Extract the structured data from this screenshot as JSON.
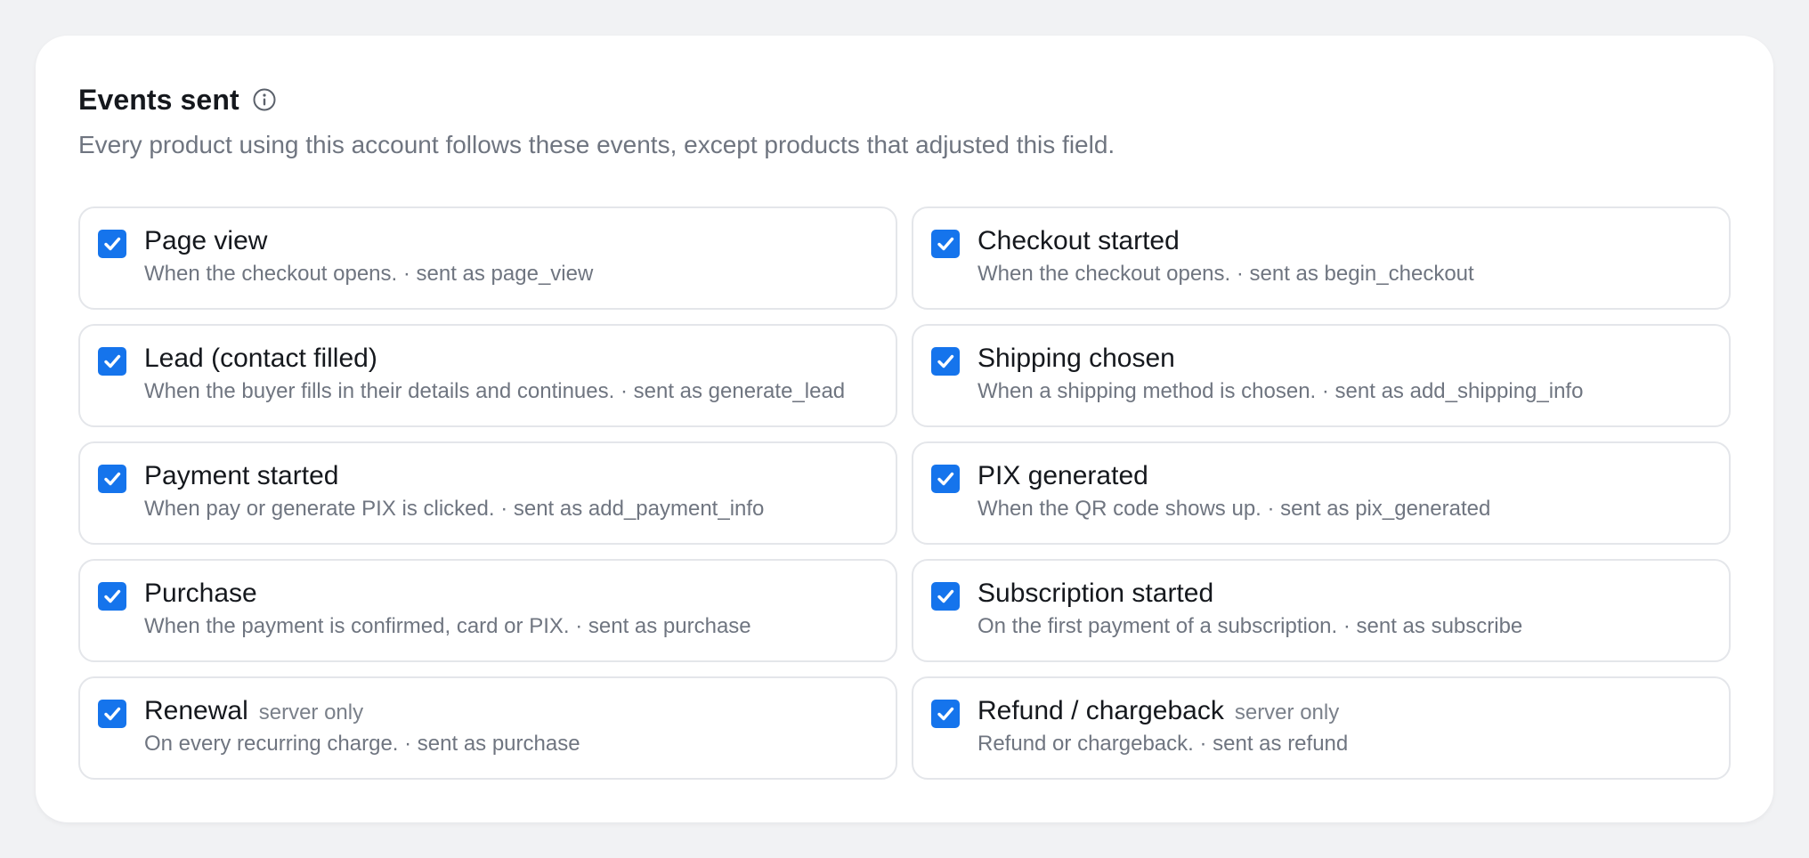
{
  "section": {
    "title": "Events sent",
    "subtitle": "Every product using this account follows these events, except products that adjusted this field."
  },
  "colors": {
    "accent": "#1574ec",
    "background": "#f1f2f4",
    "card": "#ffffff"
  },
  "icons": {
    "info": "info-circle-icon",
    "checkbox": "checkmark-icon"
  },
  "events": [
    {
      "name": "Page view",
      "tag": "",
      "description": "When the checkout opens. · sent as page_view",
      "checked": true
    },
    {
      "name": "Checkout started",
      "tag": "",
      "description": "When the checkout opens. · sent as begin_checkout",
      "checked": true
    },
    {
      "name": "Lead (contact filled)",
      "tag": "",
      "description": "When the buyer fills in their details and continues. · sent as generate_lead",
      "checked": true
    },
    {
      "name": "Shipping chosen",
      "tag": "",
      "description": "When a shipping method is chosen. · sent as add_shipping_info",
      "checked": true
    },
    {
      "name": "Payment started",
      "tag": "",
      "description": "When pay or generate PIX is clicked. · sent as add_payment_info",
      "checked": true
    },
    {
      "name": "PIX generated",
      "tag": "",
      "description": "When the QR code shows up. · sent as pix_generated",
      "checked": true
    },
    {
      "name": "Purchase",
      "tag": "",
      "description": "When the payment is confirmed, card or PIX. · sent as purchase",
      "checked": true
    },
    {
      "name": "Subscription started",
      "tag": "",
      "description": "On the first payment of a subscription. · sent as subscribe",
      "checked": true
    },
    {
      "name": "Renewal",
      "tag": "server only",
      "description": "On every recurring charge. · sent as purchase",
      "checked": true
    },
    {
      "name": "Refund / chargeback",
      "tag": "server only",
      "description": "Refund or chargeback. · sent as refund",
      "checked": true
    }
  ]
}
